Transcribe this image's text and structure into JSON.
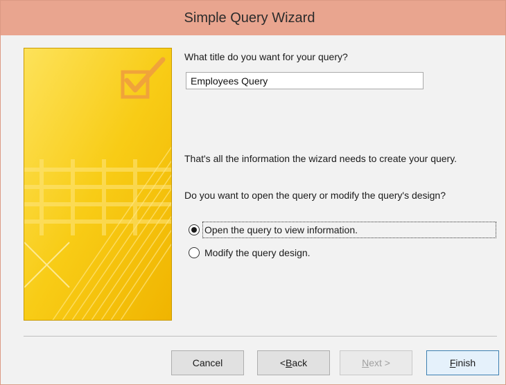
{
  "window": {
    "title": "Simple Query Wizard"
  },
  "form": {
    "title_question": "What title do you want for your query?",
    "title_value": "Employees Query",
    "info_text": "That's all the information the wizard needs to create your query.",
    "open_question": "Do you want to open the query or modify the query's design?",
    "options": [
      {
        "label": "Open the query to view information.",
        "selected": true
      },
      {
        "label": "Modify the query design.",
        "selected": false
      }
    ]
  },
  "buttons": {
    "cancel": "Cancel",
    "back_prefix": "< ",
    "back_mnemonic": "B",
    "back_rest": "ack",
    "next_mnemonic": "N",
    "next_rest": "ext >",
    "finish_mnemonic": "F",
    "finish_rest": "inish"
  },
  "colors": {
    "titlebar": "#e9a58f",
    "sidebar_yellow": "#f5c40a",
    "default_button_border": "#3c7fb1"
  }
}
